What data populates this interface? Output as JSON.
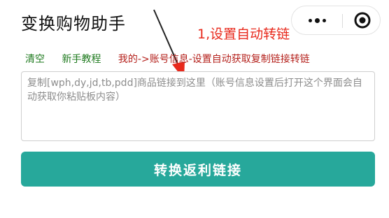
{
  "header": {
    "title": "变换购物助手"
  },
  "capsule": {
    "more_icon": "more-dots-icon",
    "close_icon": "target-circle-icon"
  },
  "annotation": {
    "text": "1,设置自动转链",
    "color": "#e8291c"
  },
  "actions": {
    "clear_label": "清空",
    "tutorial_label": "新手教程",
    "settings_path_label": "我的->账号信息-设置自动获取复制链接转链"
  },
  "input": {
    "value": "",
    "placeholder": "复制[wph,dy,jd,tb,pdd]商品链接到这里（账号信息设置后打开这个界面会自动获取你粘贴板内容）"
  },
  "convert_button": {
    "label": "转换返利链接",
    "color": "#27a89b"
  },
  "colors": {
    "green_link": "#1e7a1e",
    "red_link": "#b5231e"
  }
}
